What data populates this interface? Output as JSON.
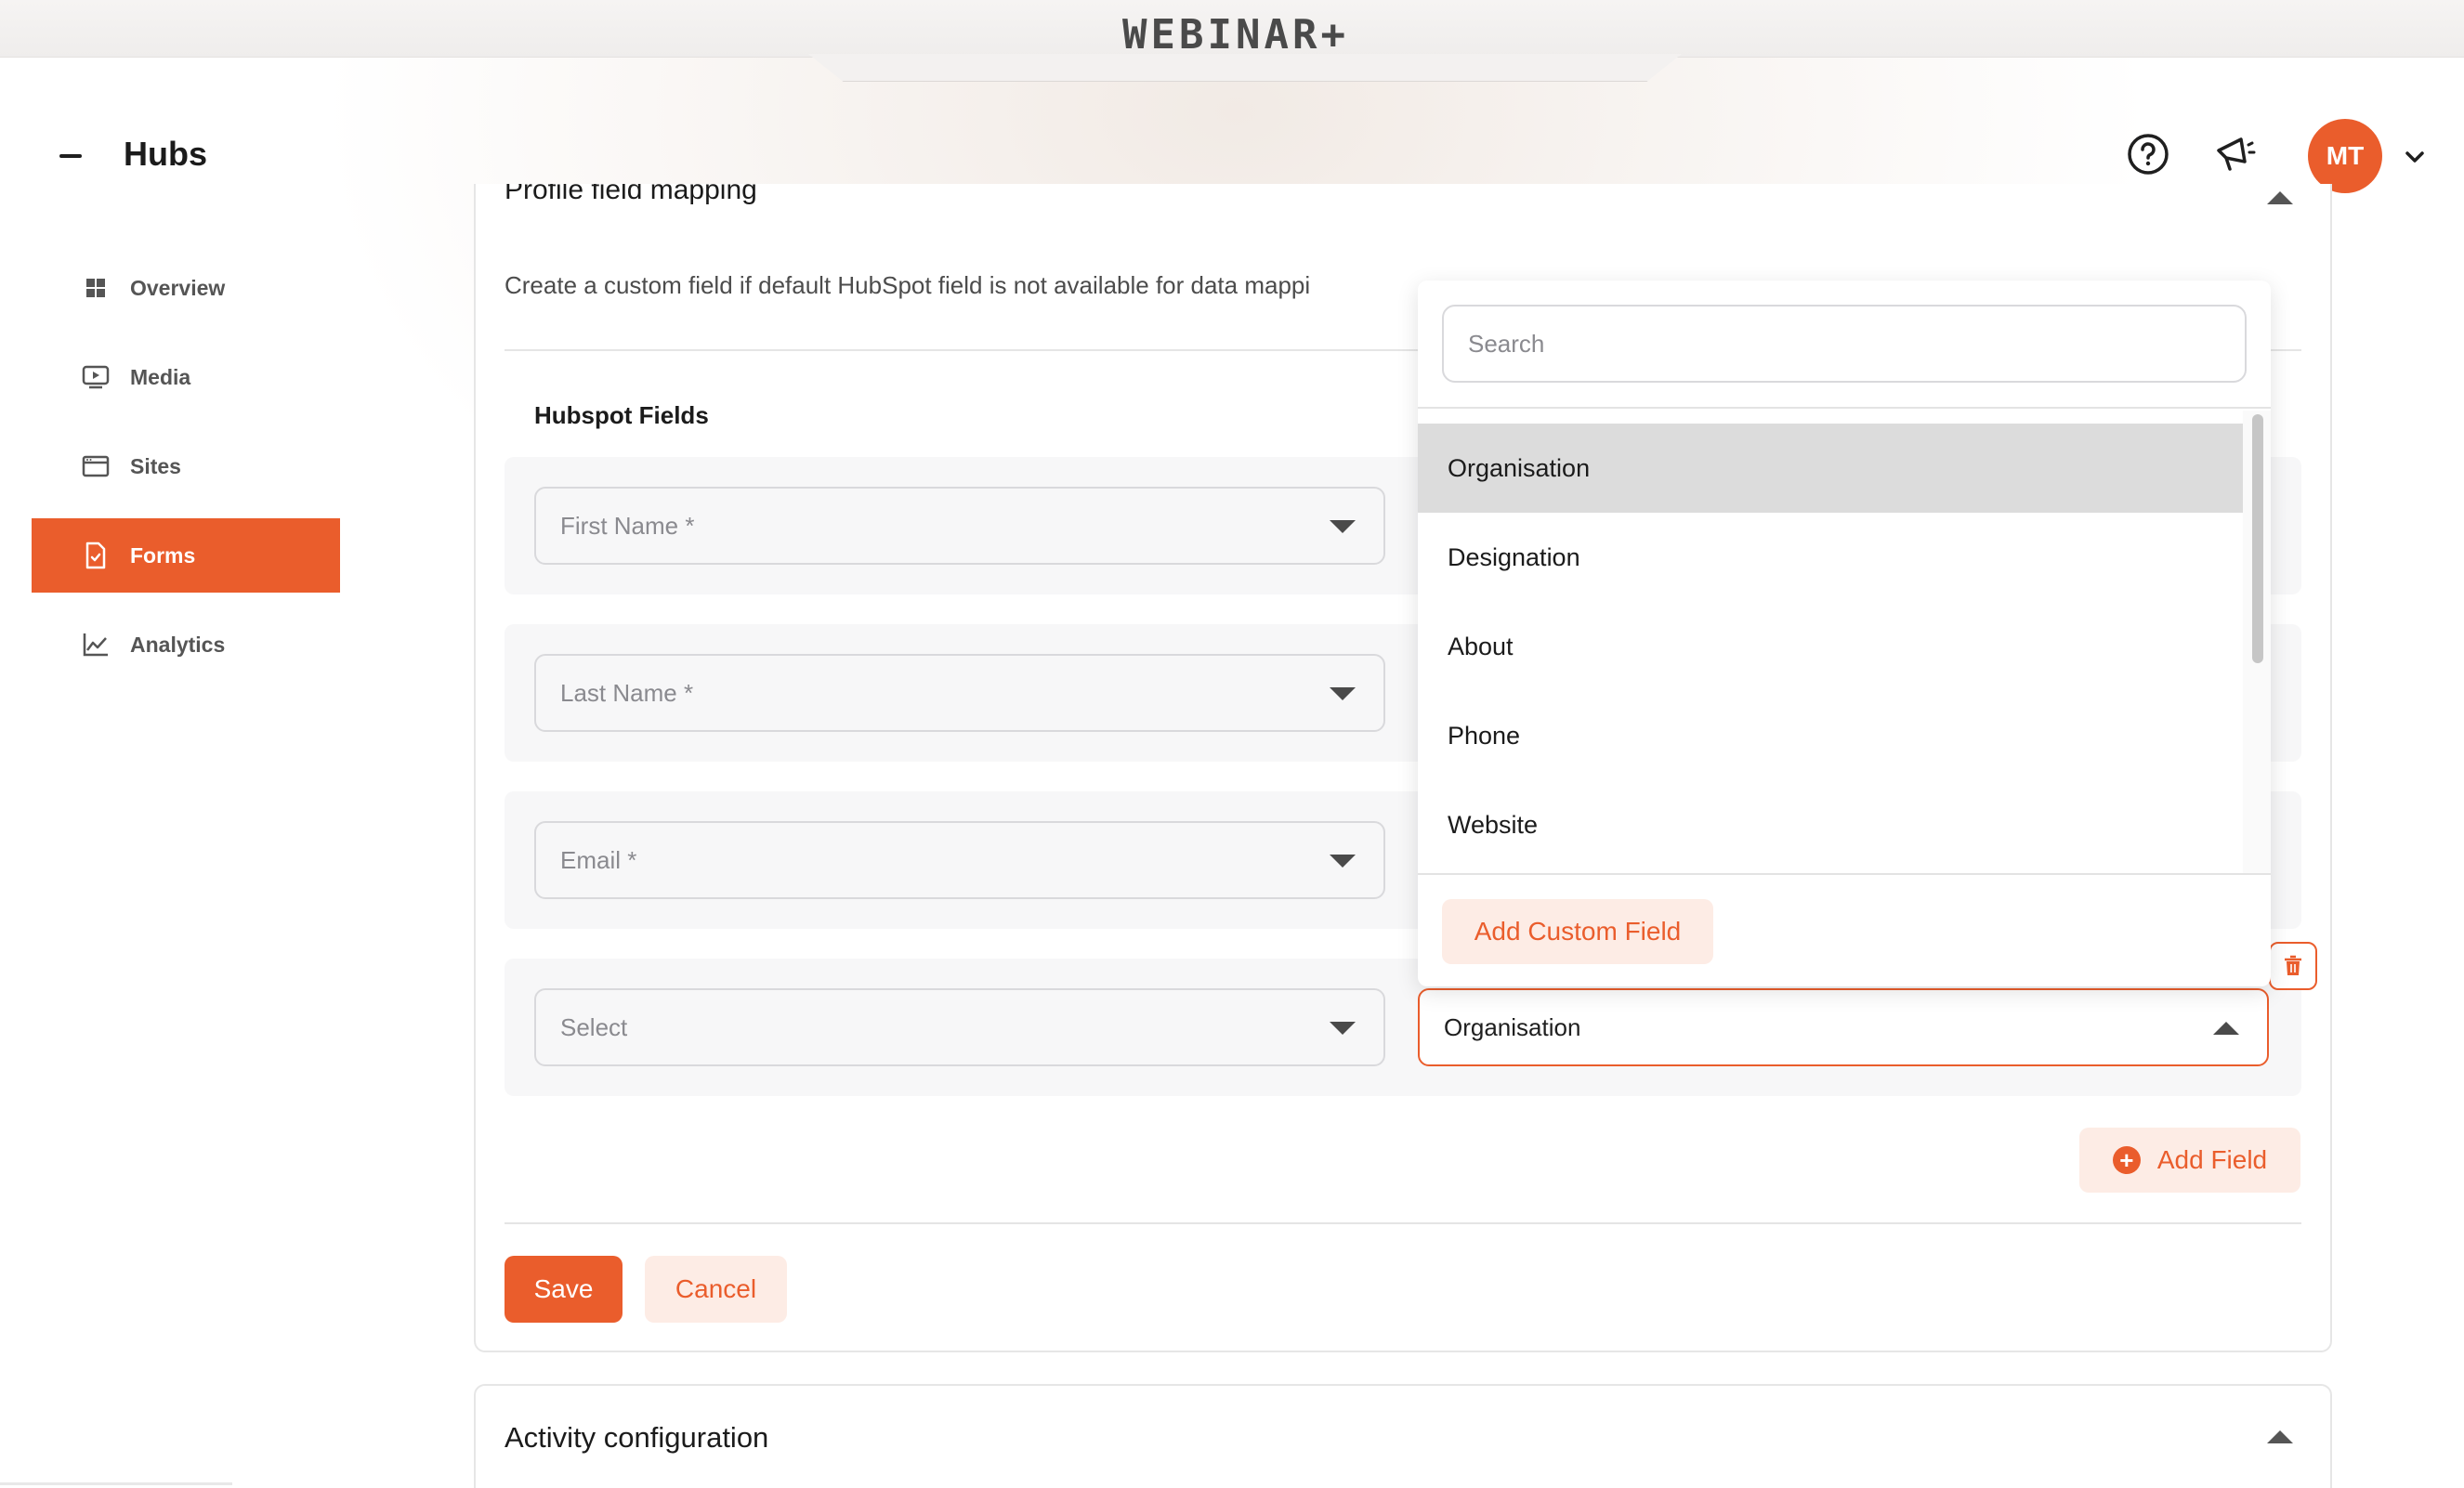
{
  "brand": {
    "logo": "WEBINAR+"
  },
  "header": {
    "title": "Hubs",
    "avatar_initials": "MT"
  },
  "sidebar": {
    "items": [
      {
        "label": "Overview",
        "icon": "grid-icon",
        "active": false
      },
      {
        "label": "Media",
        "icon": "play-screen-icon",
        "active": false
      },
      {
        "label": "Sites",
        "icon": "browser-window-icon",
        "active": false
      },
      {
        "label": "Forms",
        "icon": "form-check-icon",
        "active": true
      },
      {
        "label": "Analytics",
        "icon": "line-chart-icon",
        "active": false
      }
    ]
  },
  "profile_mapping": {
    "title": "Profile field mapping",
    "description": "Create a custom field if default HubSpot field is not available for data mappi",
    "column_label": "Hubspot Fields",
    "rows": [
      {
        "hubspot_field_placeholder": "First Name *"
      },
      {
        "hubspot_field_placeholder": "Last Name *"
      },
      {
        "hubspot_field_placeholder": "Email *"
      },
      {
        "hubspot_field_placeholder": "Select",
        "profile_field_value": "Organisation"
      }
    ],
    "add_field_label": "Add Field",
    "save_label": "Save",
    "cancel_label": "Cancel"
  },
  "dropdown": {
    "search_placeholder": "Search",
    "options": [
      "Organisation",
      "Designation",
      "About",
      "Phone",
      "Website"
    ],
    "selected": "Organisation",
    "add_custom_label": "Add Custom Field"
  },
  "activity": {
    "title": "Activity configuration"
  },
  "colors": {
    "accent": "#ea5d2c",
    "accent_light": "#fdece5"
  }
}
